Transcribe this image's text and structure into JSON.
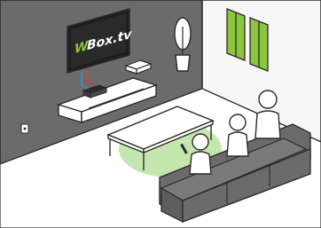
{
  "tv": {
    "logo_mark": "W",
    "logo_text": "Box.tv"
  },
  "colors": {
    "wall": "#6b6b6b",
    "wall_light": "#f7f7f7",
    "accent_green": "#8cc63f",
    "highlight_green": "#b9e3a0",
    "line": "#2b2b2b",
    "cable_blue": "#3a8fd8",
    "cable_red": "#e23b3b"
  }
}
